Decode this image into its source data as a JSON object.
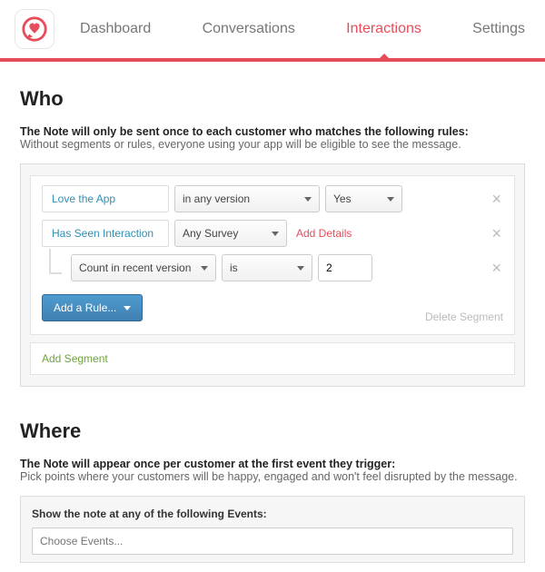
{
  "nav": {
    "tabs": [
      {
        "label": "Dashboard"
      },
      {
        "label": "Conversations"
      },
      {
        "label": "Interactions"
      },
      {
        "label": "Settings"
      }
    ],
    "active_index": 2
  },
  "who": {
    "heading": "Who",
    "lead_strong": "The Note will only be sent once to each customer who matches the following rules:",
    "lead_sub": "Without segments or rules, everyone using your app will be eligible to see the message.",
    "rules": [
      {
        "chip": "Love the App",
        "version": "in any version",
        "value": "Yes"
      },
      {
        "chip": "Has Seen Interaction",
        "survey": "Any Survey",
        "add_details": "Add Details",
        "sub": {
          "metric": "Count in recent version",
          "op": "is",
          "val": "2"
        }
      }
    ],
    "add_rule": "Add a Rule...",
    "delete_segment": "Delete Segment",
    "add_segment": "Add Segment"
  },
  "where": {
    "heading": "Where",
    "lead_strong": "The Note will appear once per customer at the first event they trigger:",
    "lead_sub": "Pick points where your customers will be happy, engaged and won't feel disrupted by the message.",
    "events_label": "Show the note at any of the following Events:",
    "events_placeholder": "Choose Events..."
  }
}
